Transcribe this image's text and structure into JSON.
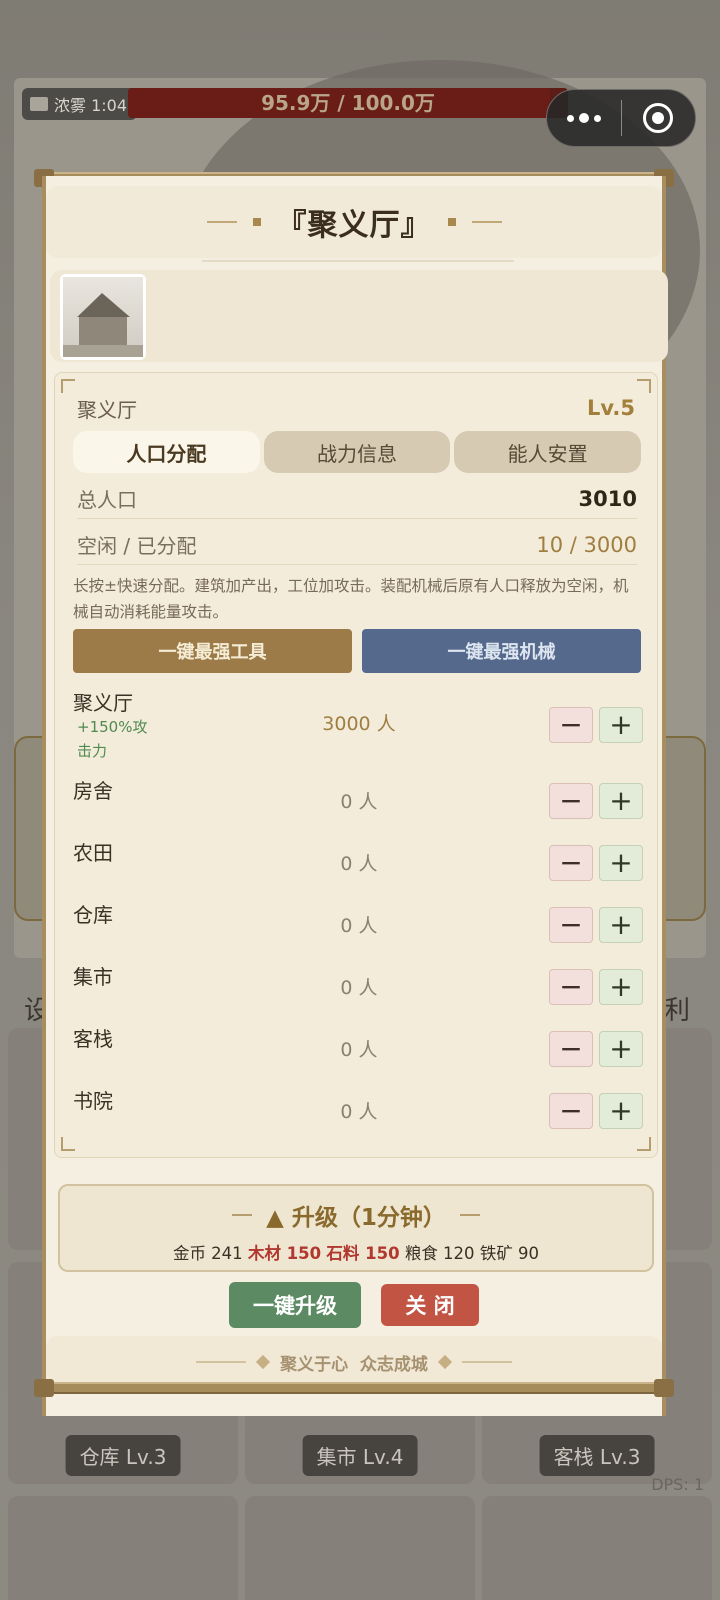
{
  "hud": {
    "weather_label": "浓雾 1:04",
    "boss_hp_text": "95.9万 / 100.0万",
    "boss_hp_fraction": 0.959
  },
  "background": {
    "row_left_char": "设",
    "row_right_char": "利",
    "tiles": [
      "仓库 Lv.3",
      "集市 Lv.4",
      "客栈 Lv.3"
    ],
    "dps_label": "DPS: 1"
  },
  "modal": {
    "title": "『聚义厅』",
    "building_name": "聚义厅",
    "building_level": "Lv.5",
    "tabs": [
      {
        "label": "人口分配",
        "active": true
      },
      {
        "label": "战力信息",
        "active": false
      },
      {
        "label": "能人安置",
        "active": false
      }
    ],
    "stats": [
      {
        "label": "总人口",
        "value": "3010"
      },
      {
        "label": "空闲 / 已分配",
        "value": "10 / 3000"
      }
    ],
    "hint": "长按±快速分配。建筑加产出，工位加攻击。装配机械后原有人口释放为空闲，机械自动消耗能量攻击。",
    "actions": {
      "tool_label": "一键最强工具",
      "mech_label": "一键最强机械"
    },
    "assignments": [
      {
        "name": "聚义厅",
        "bonus": "+150%攻击力",
        "count": "3000 人"
      },
      {
        "name": "房舍",
        "bonus": "",
        "count": "0 人"
      },
      {
        "name": "农田",
        "bonus": "",
        "count": "0 人"
      },
      {
        "name": "仓库",
        "bonus": "",
        "count": "0 人"
      },
      {
        "name": "集市",
        "bonus": "",
        "count": "0 人"
      },
      {
        "name": "客栈",
        "bonus": "",
        "count": "0 人"
      },
      {
        "name": "书院",
        "bonus": "",
        "count": "0 人"
      }
    ],
    "step_minus": "−",
    "step_plus": "+",
    "upgrade": {
      "title": "▲ 升级（1分钟）",
      "costs": [
        {
          "label": "金币 241",
          "highlight": false
        },
        {
          "label": "木材 150",
          "highlight": true
        },
        {
          "label": "石料 150",
          "highlight": true
        },
        {
          "label": "粮食 120",
          "highlight": false
        },
        {
          "label": "铁矿 90",
          "highlight": false
        }
      ]
    },
    "one_click_upgrade_label": "一键升级",
    "close_label": "关 闭",
    "motto": "聚义于心  众志成城"
  },
  "colors": {
    "modal_bg": "#f4efe1",
    "gold_text": "#a07e40",
    "upgrade_green": "#5b8a63",
    "close_red": "#c25444",
    "mech_blue": "#54698c",
    "tool_brown": "#9c7b48"
  }
}
